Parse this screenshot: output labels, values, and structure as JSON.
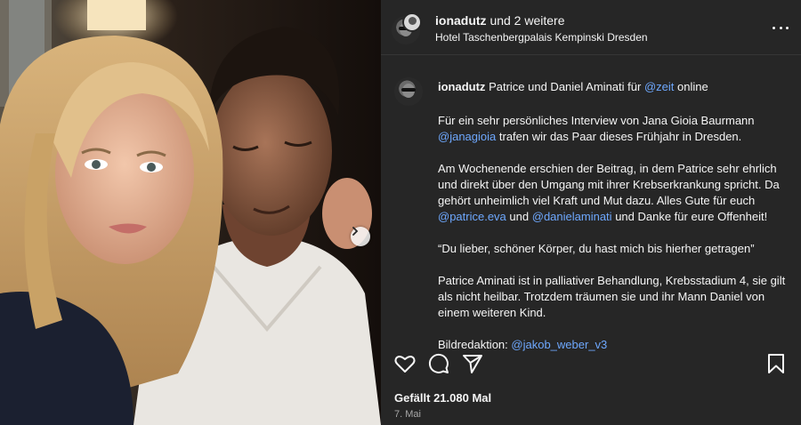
{
  "post": {
    "owner": {
      "username": "ionadutz",
      "collab_suffix": "und 2 weitere",
      "location": "Hotel Taschenbergpalais Kempinski Dresden"
    },
    "caption": {
      "username": "ionadutz",
      "line1_pre": "Patrice und Daniel Aminati für",
      "line1_mention": "@zeit",
      "line1_post": "online",
      "p2_text": "Für ein sehr persönliches Interview von Jana Gioia Baurmann",
      "p2_mention": "@janagioia",
      "p2_post": "trafen wir das Paar dieses Frühjahr in Dresden.",
      "p3_text": "Am Wochenende erschien der Beitrag, in dem Patrice sehr ehrlich und direkt über den Umgang mit ihrer Krebserkrankung spricht. Da gehört unheimlich viel Kraft und Mut dazu. Alles Gute für euch",
      "p3_mention1": "@patrice.eva",
      "p3_mid": "und",
      "p3_mention2": "@danielaminati",
      "p3_post": "und Danke für eure Offenheit!",
      "p4_quote": "“Du lieber, schöner Körper, du hast mich bis hierher getragen”",
      "p5_text": "Patrice Aminati ist in palliativer Behandlung, Krebsstadium 4, sie gilt als nicht heilbar. Trotzdem träumen sie und ihr Mann Daniel von einem weiteren Kind.",
      "credit_label": "Bildredaktion:",
      "credit_mention": "@jakob_weber_v3"
    },
    "likes_text": "Gefällt 21.080 Mal",
    "date_text": "7. Mai",
    "icons": {
      "like": "heart-icon",
      "comment": "comment-icon",
      "share": "paper-plane-icon",
      "save": "bookmark-icon",
      "more": "more-options-icon",
      "next": "chevron-right-icon"
    },
    "colors": {
      "panel_bg": "#262626",
      "mention": "#6ea8fe",
      "text": "#f5f5f5",
      "muted": "#a8a8a8"
    }
  }
}
